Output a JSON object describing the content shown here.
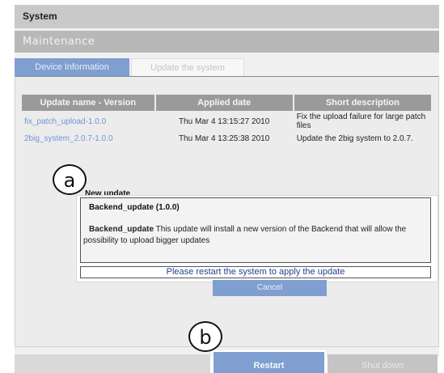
{
  "header": {
    "section_title": "System",
    "subsection_title": "Maintenance"
  },
  "tabs": [
    {
      "label": "Device Information",
      "active": false
    },
    {
      "label": "Update the system",
      "active": true
    }
  ],
  "updates_table": {
    "columns": [
      "Update name - Version",
      "Applied date",
      "Short description"
    ],
    "rows": [
      {
        "name": "fix_patch_upload-1.0.0",
        "date": "Thu Mar 4 13:15:27 2010",
        "description": "Fix the upload failure for large patch files"
      },
      {
        "name": "2big_system_2.0.7-1.0.0",
        "date": "Thu Mar 4 13:25:38 2010",
        "description": "Update the 2big system to 2.0.7."
      }
    ]
  },
  "new_update": {
    "label": "New update",
    "title": "Backend_update (1.0.0)",
    "desc_name": "Backend_update",
    "desc_text": " This update will install a new version of the Backend that will allow the possibility to upload bigger updates",
    "restart_message": "Please restart the system to apply the update"
  },
  "buttons": {
    "cancel": "Cancel",
    "restart": "Restart",
    "shutdown": "Shut down"
  },
  "callouts": {
    "a": "a",
    "b": "b"
  },
  "colors": {
    "accent_blue": "#7f9fd0",
    "link_blue": "#6f96d6",
    "header_gray": "#c9c9c9",
    "message_blue": "#243f8f"
  }
}
